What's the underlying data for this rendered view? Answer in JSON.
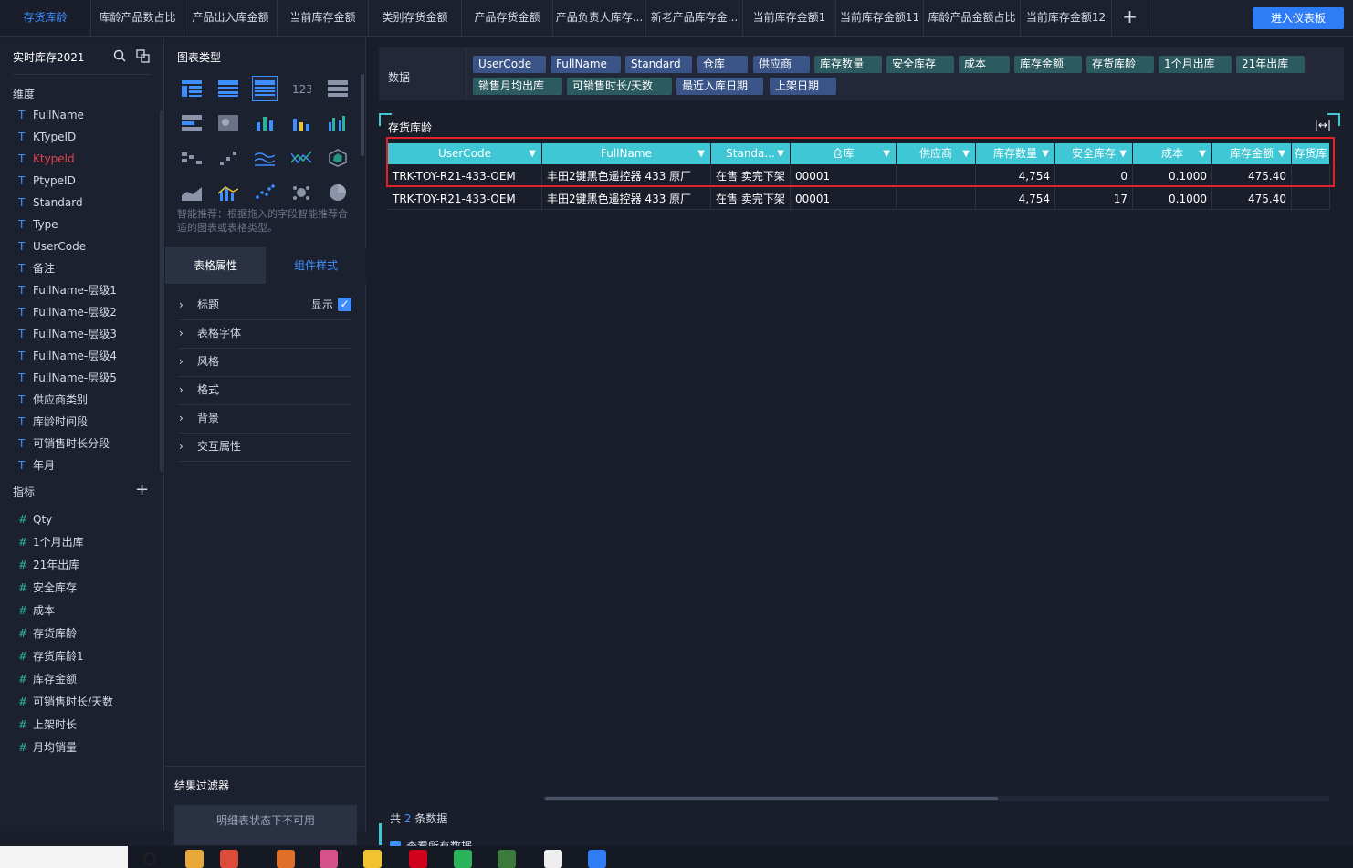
{
  "topbar": {
    "tabs": [
      {
        "label": "存货库龄",
        "active": true
      },
      {
        "label": "库龄产品数占比"
      },
      {
        "label": "产品出入库金额"
      },
      {
        "label": "当前库存金额"
      },
      {
        "label": "类别存货金额"
      },
      {
        "label": "产品存货金额"
      },
      {
        "label": "产品负责人库存..."
      },
      {
        "label": "新老产品库存金..."
      },
      {
        "label": "当前库存金额1"
      },
      {
        "label": "当前库存金额11"
      },
      {
        "label": "库龄产品金额占比"
      },
      {
        "label": "当前库存金额12"
      }
    ],
    "add_label": "+",
    "enter_dashboard_label": "进入仪表板"
  },
  "left_panel": {
    "dataset_name": "实时库存2021",
    "dimensions_title": "维度",
    "dimensions": [
      "FullName",
      "KTypeID",
      "Ktypeld",
      "PtypeID",
      "Standard",
      "Type",
      "UserCode",
      "备注",
      "FullName-层级1",
      "FullName-层级2",
      "FullName-层级3",
      "FullName-层级4",
      "FullName-层级5",
      "供应商类别",
      "库龄时间段",
      "可销售时长分段",
      "年月"
    ],
    "dimension_type_glyph": "T",
    "metrics_title": "指标",
    "metric_type_glyph": "#",
    "metrics": [
      "Qty",
      "1个月出库",
      "21年出库",
      "安全库存",
      "成本",
      "存货库龄",
      "存货库龄1",
      "库存金额",
      "可销售时长/天数",
      "上架时长",
      "月均销量"
    ]
  },
  "mid_panel": {
    "chart_type_title": "图表类型",
    "chart_icons": [
      "crosstab",
      "grouped-table",
      "detail-table",
      "kpi-number",
      "list-card",
      "progress-table",
      "heatmap",
      "stacked-bar",
      "bar",
      "grouped-bar",
      "waterfall",
      "scatter-step",
      "line",
      "combo-line",
      "radar",
      "area",
      "bar-line-combo",
      "scatter",
      "bubble",
      "pie"
    ],
    "kpi_icon_text": "123",
    "smart_hint": "智能推荐：根据拖入的字段智能推荐合适的图表或表格类型。",
    "tab_table_props": "表格属性",
    "tab_component_style": "组件样式",
    "sections": [
      "标题",
      "表格字体",
      "风格",
      "格式",
      "背景",
      "交互属性"
    ],
    "title_show_label": "显示",
    "title_show_checked": true,
    "filter_title": "结果过滤器",
    "filter_unavailable": "明细表状态下不可用"
  },
  "data_bar": {
    "label": "数据",
    "fields": [
      {
        "label": "UserCode",
        "kind": "dim"
      },
      {
        "label": "FullName",
        "kind": "dim"
      },
      {
        "label": "Standard",
        "kind": "dim"
      },
      {
        "label": "仓库",
        "kind": "dim"
      },
      {
        "label": "供应商",
        "kind": "dim"
      },
      {
        "label": "库存数量",
        "kind": "met"
      },
      {
        "label": "安全库存",
        "kind": "met"
      },
      {
        "label": "成本",
        "kind": "met"
      },
      {
        "label": "库存金额",
        "kind": "met"
      },
      {
        "label": "存货库龄",
        "kind": "met"
      },
      {
        "label": "1个月出库",
        "kind": "met"
      },
      {
        "label": "21年出库",
        "kind": "met"
      },
      {
        "label": "销售月均出库",
        "kind": "met"
      },
      {
        "label": "可销售时长/天数",
        "kind": "met"
      },
      {
        "label": "最近入库日期",
        "kind": "dim"
      },
      {
        "label": "上架日期",
        "kind": "dim"
      }
    ]
  },
  "table": {
    "title": "存货库龄",
    "expand_icon": "|↔|",
    "columns": [
      "UserCode",
      "FullName",
      "Standa...",
      "仓库",
      "供应商",
      "库存数量",
      "安全库存",
      "成本",
      "库存金额",
      "存货库"
    ],
    "rows": [
      [
        "TRK-TOY-R21-433-OEM",
        "丰田2键黑色遥控器 433 原厂",
        "在售 卖完下架",
        "00001",
        "",
        "4,754",
        "0",
        "0.1000",
        "475.40",
        ""
      ],
      [
        "TRK-TOY-R21-433-OEM",
        "丰田2键黑色遥控器 433 原厂",
        "在售 卖完下架",
        "00001",
        "",
        "4,754",
        "17",
        "0.1000",
        "475.40",
        ""
      ]
    ],
    "total_prefix": "共",
    "total_count": "2",
    "total_suffix": "条数据",
    "view_all_label": "查看所有数据",
    "view_all_checked": true
  },
  "colors": {
    "accent": "#3d8fff",
    "header_teal": "#3fc7d5",
    "highlight_red": "#e0232a",
    "background": "#1a1e2b"
  }
}
